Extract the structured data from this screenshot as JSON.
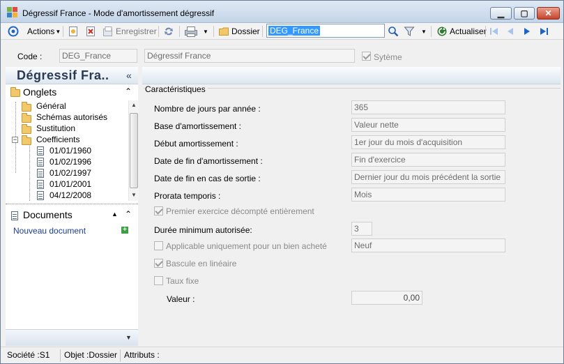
{
  "window": {
    "title": "Dégressif France -  Mode d'amortissement dégressif"
  },
  "toolbar": {
    "actions_label": "Actions",
    "save_label": "Enregistrer",
    "folder_label": "Dossier",
    "search_value": "DEG_France",
    "refresh_label": "Actualiser"
  },
  "codebar": {
    "code_label": "Code :",
    "code_value": "DEG_France",
    "name_value": "Dégressif France",
    "system_label": "Sytème",
    "system_checked": true
  },
  "leftpanel": {
    "title": "Dégressif Fra..",
    "collapse_glyph": "«",
    "tabs_title": "Onglets",
    "tree": [
      {
        "label": "Général",
        "type": "folder"
      },
      {
        "label": "Schémas autorisés",
        "type": "folder"
      },
      {
        "label": "Sustitution",
        "type": "folder"
      },
      {
        "label": "Coefficients",
        "type": "folder-open"
      },
      {
        "label": "01/01/1960",
        "type": "doc"
      },
      {
        "label": "01/02/1996",
        "type": "doc"
      },
      {
        "label": "01/02/1997",
        "type": "doc"
      },
      {
        "label": "01/01/2001",
        "type": "doc"
      },
      {
        "label": "04/12/2008",
        "type": "doc"
      }
    ],
    "documents_title": "Documents",
    "new_document": "Nouveau document"
  },
  "form": {
    "group_title": "Caractéristiques",
    "days_label": "Nombre de jours par année :",
    "days_value": "365",
    "base_label": "Base d'amortissement :",
    "base_value": "Valeur nette",
    "start_label": "Début amortissement :",
    "start_value": "1er jour du mois d'acquisition",
    "end_label": "Date de fin d'amortissement :",
    "end_value": "Fin d'exercice",
    "exit_label": "Date de fin en cas de sortie :",
    "exit_value": "Dernier jour du mois précédent la sortie",
    "prorata_label": "Prorata temporis :",
    "prorata_value": "Mois",
    "first_year_label": "Premier exercice décompté entièrement",
    "min_duration_label": "Durée minimum autorisée:",
    "min_duration_value": "3",
    "bought_only_label": "Applicable uniquement pour un bien acheté",
    "bought_only_value": "Neuf",
    "linear_label": "Bascule en linéaire",
    "fixed_rate_label": "Taux fixe",
    "value_label": "Valeur :",
    "value_value": "0,00"
  },
  "statusbar": {
    "company": "Société :S1",
    "object": "Objet :Dossier",
    "attributes": "Attributs :"
  },
  "colors": {
    "accent_blue": "#1c64c8",
    "link_blue": "#1a3c9c",
    "header_text": "#2a3a52"
  }
}
